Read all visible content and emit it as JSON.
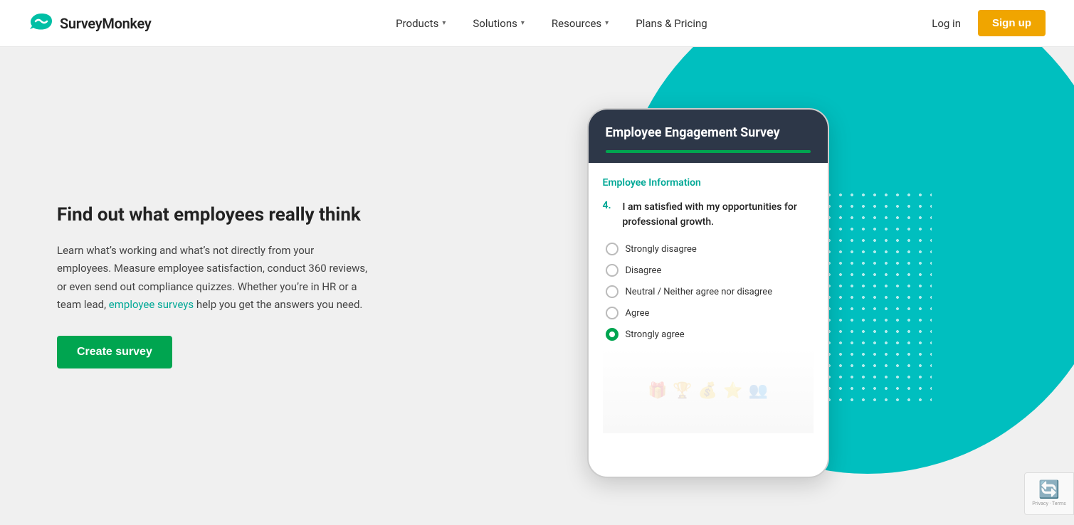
{
  "nav": {
    "logo_text": "SurveyMonkey",
    "items": [
      {
        "label": "Products",
        "has_dropdown": true
      },
      {
        "label": "Solutions",
        "has_dropdown": true
      },
      {
        "label": "Resources",
        "has_dropdown": true
      },
      {
        "label": "Plans & Pricing",
        "has_dropdown": false
      }
    ],
    "login_label": "Log in",
    "signup_label": "Sign up"
  },
  "hero": {
    "title": "Find out what employees really think",
    "description_part1": "Learn what’s working and what’s not directly from your employees. Measure employee satisfaction, conduct 360 reviews, or even send out compliance quizzes. Whether you’re in HR or a team lead, ",
    "link_text": "employee surveys",
    "description_part2": " help you get the answers you need.",
    "cta_label": "Create survey"
  },
  "phone": {
    "header_title": "Employee Engagement Survey",
    "section_title": "Employee Information",
    "question_number": "4.",
    "question_text": "I am satisfied with my opportunities for professional growth.",
    "options": [
      {
        "label": "Strongly disagree",
        "selected": false
      },
      {
        "label": "Disagree",
        "selected": false
      },
      {
        "label": "Neutral / Neither agree nor disagree",
        "selected": false
      },
      {
        "label": "Agree",
        "selected": false
      },
      {
        "label": "Strongly agree",
        "selected": true
      }
    ]
  },
  "recaptcha": {
    "text": "Privacy · Terms"
  }
}
